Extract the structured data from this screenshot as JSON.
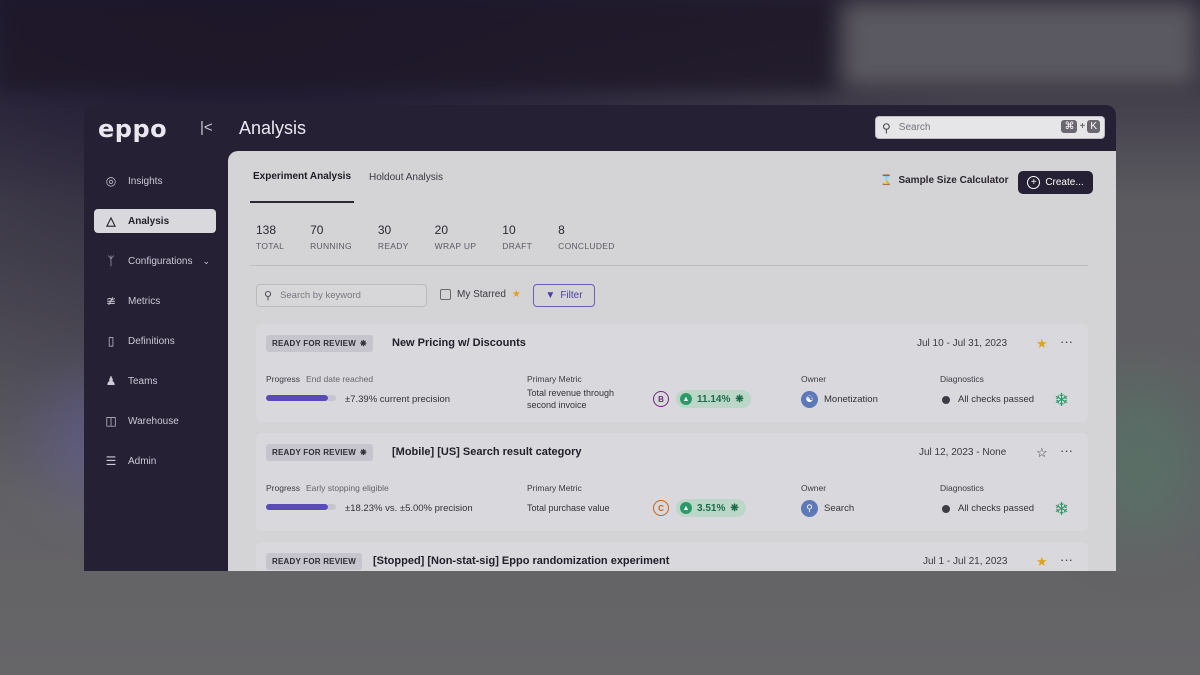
{
  "app": {
    "logo": "eppo",
    "page_title": "Analysis"
  },
  "search": {
    "placeholder": "Search",
    "shortcut_cmd": "⌘",
    "shortcut_plus": "+",
    "shortcut_key": "K"
  },
  "sidebar": {
    "items": [
      {
        "label": "Insights",
        "icon": "lightbulb-icon"
      },
      {
        "label": "Analysis",
        "icon": "flask-icon"
      },
      {
        "label": "Configurations",
        "icon": "branch-icon"
      },
      {
        "label": "Metrics",
        "icon": "trend-icon"
      },
      {
        "label": "Definitions",
        "icon": "book-icon"
      },
      {
        "label": "Teams",
        "icon": "users-icon"
      },
      {
        "label": "Warehouse",
        "icon": "database-icon"
      },
      {
        "label": "Admin",
        "icon": "sliders-icon"
      }
    ]
  },
  "tabs": {
    "experiment": "Experiment Analysis",
    "holdout": "Holdout Analysis"
  },
  "toolbar": {
    "sample_size": "Sample Size Calculator",
    "create": "Create..."
  },
  "stats": [
    {
      "n": "138",
      "l": "TOTAL"
    },
    {
      "n": "70",
      "l": "RUNNING"
    },
    {
      "n": "30",
      "l": "READY"
    },
    {
      "n": "20",
      "l": "WRAP UP"
    },
    {
      "n": "10",
      "l": "DRAFT"
    },
    {
      "n": "8",
      "l": "CONCLUDED"
    }
  ],
  "filters": {
    "keyword_placeholder": "Search by keyword",
    "my_starred": "My Starred",
    "filter": "Filter"
  },
  "labels": {
    "progress": "Progress",
    "primary_metric": "Primary Metric",
    "owner": "Owner",
    "diagnostics": "Diagnostics"
  },
  "cards": [
    {
      "badge": "READY FOR REVIEW",
      "title": "New Pricing w/ Discounts",
      "date": "Jul 10 - Jul 31, 2023",
      "starred": true,
      "progress_note": "End date reached",
      "progress_value": "±7.39% current precision",
      "metric_line1": "Total revenue through",
      "metric_line2": "second invoice",
      "metric_grade": "B",
      "lift": "11.14%",
      "owner": "Monetization",
      "diagnostics": "All checks passed"
    },
    {
      "badge": "READY FOR REVIEW",
      "title": "[Mobile] [US] Search result category",
      "date": "Jul 12, 2023 - None",
      "starred": false,
      "progress_note": "Early stopping eligible",
      "progress_value": "±18.23% vs. ±5.00% precision",
      "metric_line1": "Total purchase value",
      "metric_line2": "",
      "metric_grade": "C",
      "lift": "3.51%",
      "owner": "Search",
      "diagnostics": "All checks passed"
    },
    {
      "badge": "READY FOR REVIEW",
      "title": "[Stopped] [Non-stat-sig] Eppo randomization experiment",
      "date": "Jul 1 - Jul 21, 2023",
      "starred": true
    }
  ],
  "colors": {
    "accent": "#5a4bb8",
    "success": "#2a9a6a",
    "sidebar": "#262034",
    "star": "#e0a21c"
  }
}
